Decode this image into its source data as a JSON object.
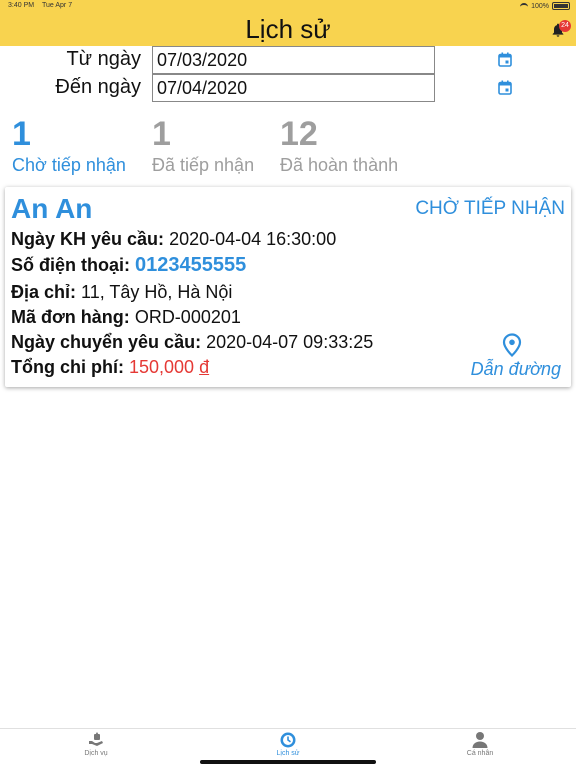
{
  "status": {
    "time": "3:40 PM",
    "date": "Tue Apr 7",
    "battery": "100%"
  },
  "header": {
    "title": "Lịch sử",
    "notification_count": "24"
  },
  "filters": {
    "from_label": "Từ ngày",
    "from_value": "07/03/2020",
    "to_label": "Đến ngày",
    "to_value": "07/04/2020"
  },
  "counters": [
    {
      "count": "1",
      "label": "Chờ tiếp nhận"
    },
    {
      "count": "1",
      "label": "Đã tiếp nhận"
    },
    {
      "count": "12",
      "label": "Đã hoàn thành"
    }
  ],
  "order": {
    "customer_name": "An An",
    "status": "CHỜ TIẾP NHẬN",
    "requested_date_label": "Ngày KH yêu cầu:",
    "requested_date": "2020-04-04 16:30:00",
    "phone_label": "Số điện thoại:",
    "phone": "0123455555",
    "address_label": "Địa chỉ:",
    "address": "11, Tây Hồ, Hà Nội",
    "order_code_label": "Mã đơn hàng:",
    "order_code": "ORD-000201",
    "transfer_date_label": "Ngày chuyển yêu cầu:",
    "transfer_date": "2020-04-07 09:33:25",
    "total_label": "Tổng chi phí:",
    "total": "150,000",
    "currency": "đ",
    "direction_label": "Dẫn đường"
  },
  "tabbar": {
    "tabs": [
      {
        "label": "Dịch vụ",
        "icon": "service-icon"
      },
      {
        "label": "Lịch sử",
        "icon": "history-icon"
      },
      {
        "label": "Cá nhân",
        "icon": "person-icon"
      }
    ]
  },
  "colors": {
    "header": "#f8d34f",
    "accent": "#2f8fdc",
    "cost": "#e53935",
    "inactive": "#9e9e9e"
  }
}
